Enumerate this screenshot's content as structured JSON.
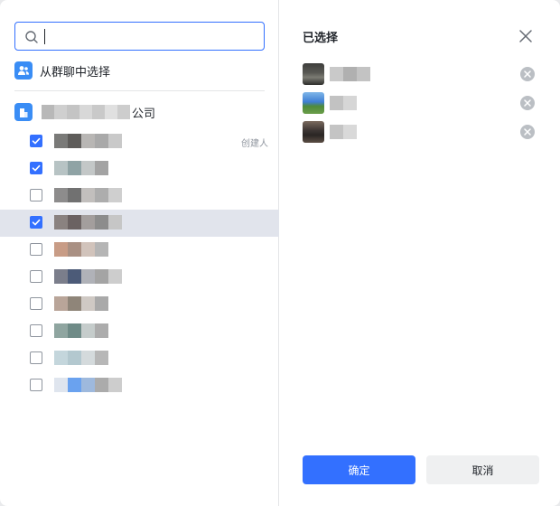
{
  "search": {
    "placeholder": ""
  },
  "select_from_group": {
    "label": "从群聊中选择",
    "icon": "group-chat-icon"
  },
  "organization": {
    "name_suffix": "公司",
    "icon": "organization-icon"
  },
  "members": [
    {
      "checked": true,
      "highlighted": false,
      "tag": "创建人",
      "colors": [
        "#7a7a78",
        "#5e5c5a",
        "#b8b6b4",
        "#a9a9a9",
        "#c9c9c9"
      ]
    },
    {
      "checked": true,
      "highlighted": false,
      "tag": "",
      "colors": [
        "#b7c3c4",
        "#8fa3a5",
        "#c3c7c7",
        "#a3a3a3"
      ]
    },
    {
      "checked": false,
      "highlighted": false,
      "tag": "",
      "colors": [
        "#8d8c8c",
        "#717171",
        "#c2bfbd",
        "#adadad",
        "#cfcfcf"
      ]
    },
    {
      "checked": true,
      "highlighted": true,
      "tag": "",
      "colors": [
        "#8a8280",
        "#6b6262",
        "#a39e9d",
        "#8c8c8c",
        "#c6c6c6"
      ]
    },
    {
      "checked": false,
      "highlighted": false,
      "tag": "",
      "colors": [
        "#c89c86",
        "#a99083",
        "#d1c3bb",
        "#b5b5b5"
      ]
    },
    {
      "checked": false,
      "highlighted": false,
      "tag": "",
      "colors": [
        "#7b7e8b",
        "#4c5b78",
        "#b0b2b8",
        "#a4a4a4",
        "#cdcdcd"
      ]
    },
    {
      "checked": false,
      "highlighted": false,
      "tag": "",
      "colors": [
        "#b9a599",
        "#8f8579",
        "#cfc9c4",
        "#a9a9a9"
      ]
    },
    {
      "checked": false,
      "highlighted": false,
      "tag": "",
      "colors": [
        "#8fa5a0",
        "#6f8b87",
        "#c5cccb",
        "#acacac"
      ]
    },
    {
      "checked": false,
      "highlighted": false,
      "tag": "",
      "colors": [
        "#c4d6dc",
        "#b3c8cf",
        "#d4dadc",
        "#b7b7b7"
      ]
    },
    {
      "checked": false,
      "highlighted": false,
      "tag": "",
      "colors": [
        "#dfe5ee",
        "#6aa2ef",
        "#9eb9dd",
        "#ababab",
        "#cdcdcd"
      ]
    }
  ],
  "right": {
    "title": "已选择",
    "selected": [
      {
        "avatar_colors": [
          "#5a5a55",
          "#3d3d3b",
          "#7c7c74",
          "#2c2c2a"
        ],
        "colors": [
          "#c9c9c9",
          "#b0b0b0",
          "#c3c3c3"
        ]
      },
      {
        "avatar_colors": [
          "#3f7fd4",
          "#7fb6e8",
          "#4f8a3a",
          "#6b9e4a"
        ],
        "colors": [
          "#c2c2c2",
          "#d6d6d6"
        ]
      },
      {
        "avatar_colors": [
          "#3a3432",
          "#7a6a5e",
          "#2a2624",
          "#5b4d44"
        ],
        "colors": [
          "#c4c4c4",
          "#d9d9d9"
        ]
      }
    ]
  },
  "buttons": {
    "confirm": "确定",
    "cancel": "取消"
  }
}
